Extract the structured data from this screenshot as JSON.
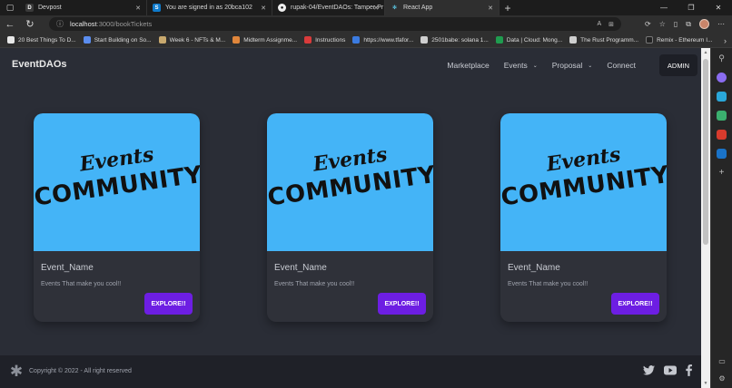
{
  "browser": {
    "tabs": [
      {
        "label": "Devpost",
        "icon": "devpost-icon",
        "active": false
      },
      {
        "label": "You are signed in as 20bca102",
        "icon": "s-logo-icon",
        "active": false
      },
      {
        "label": "rupak-04/EventDAOs: Tamper Pr",
        "icon": "github-icon",
        "active": false
      },
      {
        "label": "React App",
        "icon": "react-icon",
        "active": true
      }
    ],
    "new_tab": "+",
    "address": {
      "host": "localhost",
      "path": ":3000/bookTickets"
    },
    "bookmarks": [
      {
        "label": "20 Best Things To D...",
        "color": "#e8e8e8"
      },
      {
        "label": "Start Building on So...",
        "color": "#5b8def"
      },
      {
        "label": "Week 6 - NFTs & M...",
        "color": "#c8a96e"
      },
      {
        "label": "Midterm Assignme...",
        "color": "#e0863b"
      },
      {
        "label": "Instructions",
        "color": "#d93b3b"
      },
      {
        "label": "https://www.tfafor...",
        "color": "#3b7be0"
      },
      {
        "label": "2501babe: solana 1...",
        "color": "#cfcfcf"
      },
      {
        "label": "Data | Cloud: Mong...",
        "color": "#1f9c4f"
      },
      {
        "label": "The Rust Programm...",
        "color": "#cfcfcf"
      },
      {
        "label": "Remix - Ethereum I...",
        "color": "#222222"
      }
    ]
  },
  "app": {
    "brand": "EventDAOs",
    "nav": [
      {
        "label": "Marketplace",
        "dropdown": false
      },
      {
        "label": "Events",
        "dropdown": true
      },
      {
        "label": "Proposal",
        "dropdown": true
      },
      {
        "label": "Connect",
        "dropdown": false
      }
    ],
    "admin_label": "ADMIN",
    "image_text": {
      "line1": "Events",
      "line2": "COMMUNITY"
    },
    "cards": [
      {
        "title": "Event_Name",
        "description": "Events That make you cool!!",
        "button": "EXPLORE!!"
      },
      {
        "title": "Event_Name",
        "description": "Events That make you cool!!",
        "button": "EXPLORE!!"
      },
      {
        "title": "Event_Name",
        "description": "Events That make you cool!!",
        "button": "EXPLORE!!"
      }
    ],
    "footer": {
      "copyright": "Copyright © 2022 - All right reserved",
      "social": [
        "twitter-icon",
        "youtube-icon",
        "facebook-icon"
      ]
    }
  },
  "colors": {
    "page_bg": "#2a2d36",
    "card_bg": "#2f3139",
    "image_bg": "#44b4f7",
    "button": "#6d1ee3",
    "footer": "#1f2128"
  }
}
